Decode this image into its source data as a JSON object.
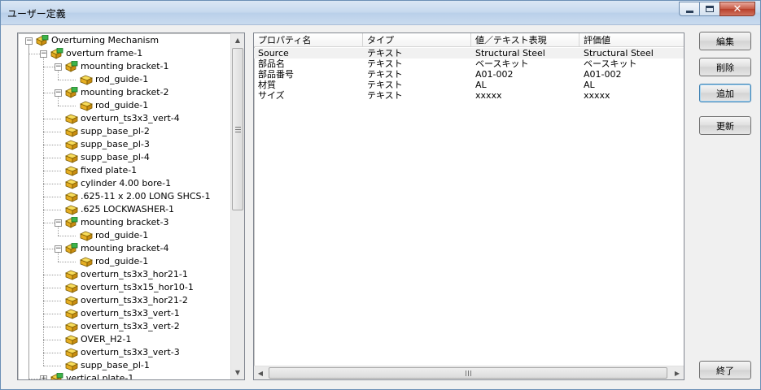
{
  "window": {
    "title": "ユーザー定義",
    "buttons": {
      "minimize": "minimize-icon",
      "maximize": "maximize-icon",
      "close": "close-icon"
    }
  },
  "tree": {
    "nodes": [
      {
        "label": "Overturning Mechanism",
        "level": 0,
        "expander": "minus",
        "icon": "assembly-icon"
      },
      {
        "label": "overturn frame-1",
        "level": 1,
        "expander": "minus",
        "icon": "assembly-icon"
      },
      {
        "label": "mounting bracket-1",
        "level": 2,
        "expander": "minus",
        "icon": "assembly-icon"
      },
      {
        "label": "rod_guide-1",
        "level": 3,
        "expander": "",
        "icon": "part-icon"
      },
      {
        "label": "mounting bracket-2",
        "level": 2,
        "expander": "minus",
        "icon": "assembly-icon"
      },
      {
        "label": "rod_guide-1",
        "level": 3,
        "expander": "",
        "icon": "part-icon"
      },
      {
        "label": "overturn_ts3x3_vert-4",
        "level": 2,
        "expander": "",
        "icon": "part-icon"
      },
      {
        "label": "supp_base_pl-2",
        "level": 2,
        "expander": "",
        "icon": "part-icon"
      },
      {
        "label": "supp_base_pl-3",
        "level": 2,
        "expander": "",
        "icon": "part-icon"
      },
      {
        "label": "supp_base_pl-4",
        "level": 2,
        "expander": "",
        "icon": "part-icon"
      },
      {
        "label": "fixed plate-1",
        "level": 2,
        "expander": "",
        "icon": "part-icon"
      },
      {
        "label": "cylinder 4.00 bore-1",
        "level": 2,
        "expander": "",
        "icon": "part-icon"
      },
      {
        "label": ".625-11 x 2.00 LONG SHCS-1",
        "level": 2,
        "expander": "",
        "icon": "part-icon"
      },
      {
        "label": ".625 LOCKWASHER-1",
        "level": 2,
        "expander": "",
        "icon": "part-icon"
      },
      {
        "label": "mounting bracket-3",
        "level": 2,
        "expander": "minus",
        "icon": "assembly-icon"
      },
      {
        "label": "rod_guide-1",
        "level": 3,
        "expander": "",
        "icon": "part-icon"
      },
      {
        "label": "mounting bracket-4",
        "level": 2,
        "expander": "minus",
        "icon": "assembly-icon"
      },
      {
        "label": "rod_guide-1",
        "level": 3,
        "expander": "",
        "icon": "part-icon"
      },
      {
        "label": "overturn_ts3x3_hor21-1",
        "level": 2,
        "expander": "",
        "icon": "part-icon"
      },
      {
        "label": "overturn_ts3x15_hor10-1",
        "level": 2,
        "expander": "",
        "icon": "part-icon"
      },
      {
        "label": "overturn_ts3x3_hor21-2",
        "level": 2,
        "expander": "",
        "icon": "part-icon"
      },
      {
        "label": "overturn_ts3x3_vert-1",
        "level": 2,
        "expander": "",
        "icon": "part-icon"
      },
      {
        "label": "overturn_ts3x3_vert-2",
        "level": 2,
        "expander": "",
        "icon": "part-icon"
      },
      {
        "label": "OVER_H2-1",
        "level": 2,
        "expander": "",
        "icon": "part-icon"
      },
      {
        "label": "overturn_ts3x3_vert-3",
        "level": 2,
        "expander": "",
        "icon": "part-icon"
      },
      {
        "label": "supp_base_pl-1",
        "level": 2,
        "expander": "",
        "icon": "part-icon"
      },
      {
        "label": "vertical plate-1",
        "level": 1,
        "expander": "plus",
        "icon": "assembly-icon"
      }
    ]
  },
  "table": {
    "columns": [
      "プロパティ名",
      "タイプ",
      "値／テキスト表現",
      "評価値"
    ],
    "rows": [
      [
        "Source",
        "テキスト",
        "Structural Steel",
        "Structural Steel"
      ],
      [
        "部品名",
        "テキスト",
        "ベースキット",
        "ベースキット"
      ],
      [
        "部品番号",
        "テキスト",
        "A01-002",
        "A01-002"
      ],
      [
        "材質",
        "テキスト",
        "AL",
        "AL"
      ],
      [
        "サイズ",
        "テキスト",
        "xxxxx",
        "xxxxx"
      ]
    ]
  },
  "actions": {
    "edit": "編集",
    "delete": "削除",
    "add": "追加",
    "refresh": "更新",
    "close": "終了"
  }
}
